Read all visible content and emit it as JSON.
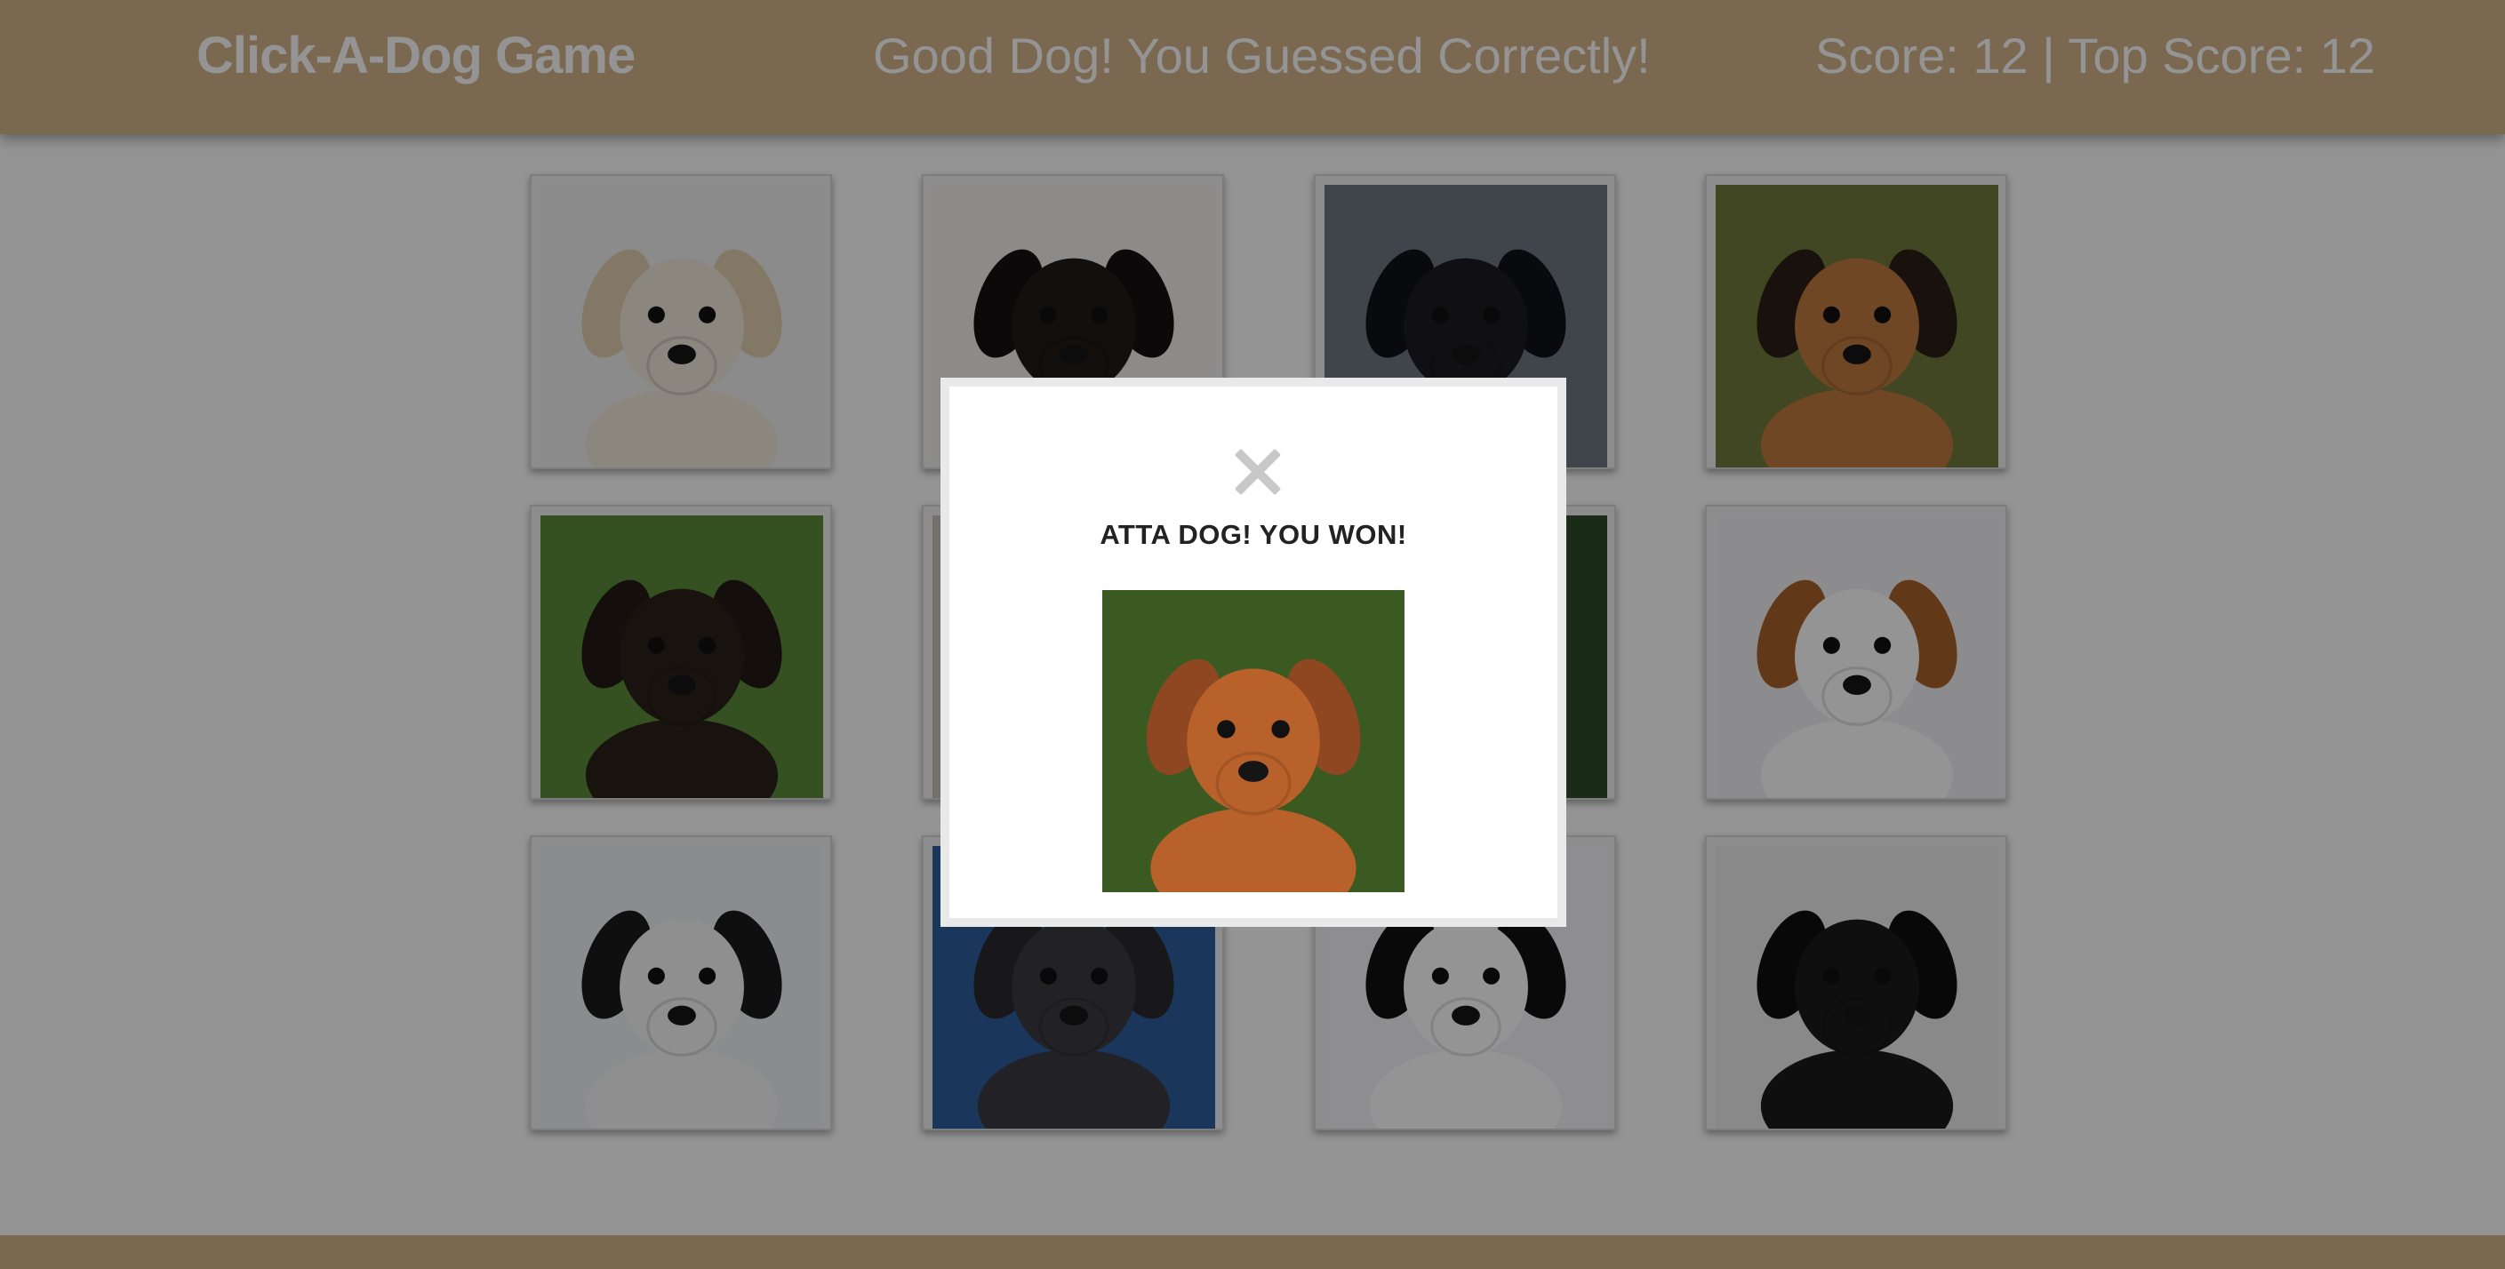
{
  "header": {
    "title": "Click-A-Dog Game",
    "message": "Good Dog! You Guessed Correctly!",
    "score_text": "Score: 12 | Top Score: 12"
  },
  "cards": [
    {
      "icon": "golden-retriever-puppy",
      "bg": "#efefef",
      "fur": "#efe7da",
      "ear": "#e2cfae"
    },
    {
      "icon": "rottweiler-puppy",
      "bg": "#f1efec",
      "fur": "#1f1a18",
      "ear": "#141110"
    },
    {
      "icon": "border-collie",
      "bg": "#6f7883",
      "fur": "#1c1d24",
      "ear": "#111217"
    },
    {
      "icon": "german-shepherd",
      "bg": "#6e7a3c",
      "fur": "#c07b3e",
      "ear": "#2a1e16"
    },
    {
      "icon": "puppy-in-polka-dot-pot",
      "bg": "#5c8a3a",
      "fur": "#2b211c",
      "ear": "#231b17"
    },
    {
      "icon": "dog-photo",
      "bg": "#c8c2b8",
      "fur": "#8a6e55",
      "ear": "#6a523f"
    },
    {
      "icon": "dog-photo",
      "bg": "#2e4a2a",
      "fur": "#5b4634",
      "ear": "#3e2f23"
    },
    {
      "icon": "beagle",
      "bg": "#f2f2f4",
      "fur": "#ffffff",
      "ear": "#a8632a"
    },
    {
      "icon": "dog-with-sunglasses",
      "bg": "#eef1f6",
      "fur": "#f6f6f6",
      "ear": "#1a1a1a"
    },
    {
      "icon": "husky-puppy",
      "bg": "#2f5d9e",
      "fur": "#3a3a42",
      "ear": "#2a2a30"
    },
    {
      "icon": "dalmatian",
      "bg": "#f4f5f8",
      "fur": "#ffffff",
      "ear": "#111111"
    },
    {
      "icon": "black-pug",
      "bg": "#ececec",
      "fur": "#1b1b1b",
      "ear": "#0e0e0e"
    }
  ],
  "modal": {
    "title": "ATTA DOG! YOU WON!",
    "close_icon": "close-icon",
    "image_icon": "happy-dog-photo",
    "colors": {
      "bg": "#3b5a22",
      "fur": "#b8612b",
      "ear": "#8e4720"
    }
  },
  "colors": {
    "header_bg": "#d4b48c",
    "text": "#ffffff",
    "overlay": "rgba(0,0,0,0.42)"
  }
}
